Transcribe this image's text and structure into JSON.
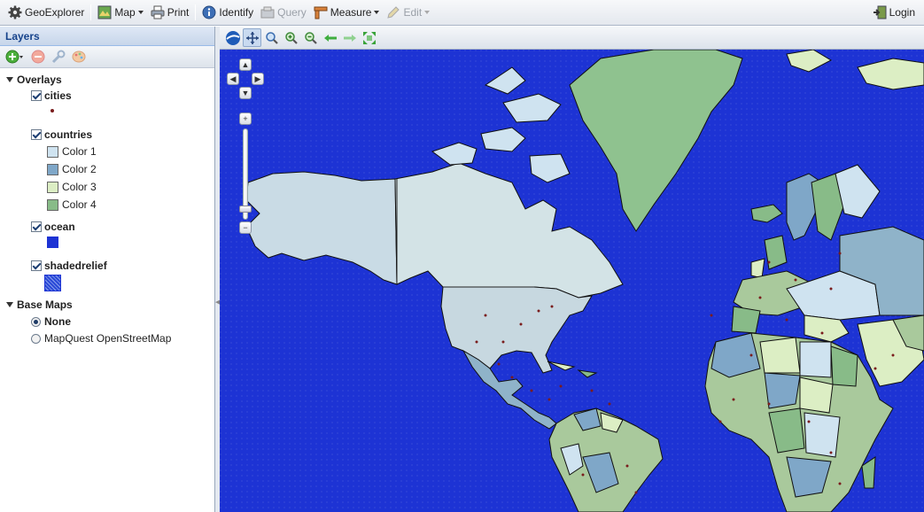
{
  "toolbar": {
    "app_title": "GeoExplorer",
    "map_label": "Map",
    "print_label": "Print",
    "identify_label": "Identify",
    "query_label": "Query",
    "measure_label": "Measure",
    "edit_label": "Edit",
    "login_label": "Login"
  },
  "layers_panel": {
    "title": "Layers",
    "overlays_label": "Overlays",
    "layers": [
      {
        "name": "cities",
        "checked": true,
        "swatch_color": "#7a1d1d"
      },
      {
        "name": "countries",
        "checked": true,
        "legend": [
          {
            "label": "Color 1",
            "color": "#cfe3f0"
          },
          {
            "label": "Color 2",
            "color": "#7fa7c8"
          },
          {
            "label": "Color 3",
            "color": "#dceec4"
          },
          {
            "label": "Color 4",
            "color": "#88bb88"
          }
        ]
      },
      {
        "name": "ocean",
        "checked": true,
        "swatch_color": "#1d33d4"
      },
      {
        "name": "shadedrelief",
        "checked": true,
        "swatch_color": "#2a49d6"
      }
    ],
    "base_maps_label": "Base Maps",
    "base_maps": [
      {
        "name": "None",
        "selected": true
      },
      {
        "name": "MapQuest OpenStreetMap",
        "selected": false
      }
    ]
  },
  "map": {
    "ocean_color": "#1d33d4",
    "land_colors": [
      "#cfe3f0",
      "#7fa7c8",
      "#dceec4",
      "#88bb88"
    ]
  }
}
